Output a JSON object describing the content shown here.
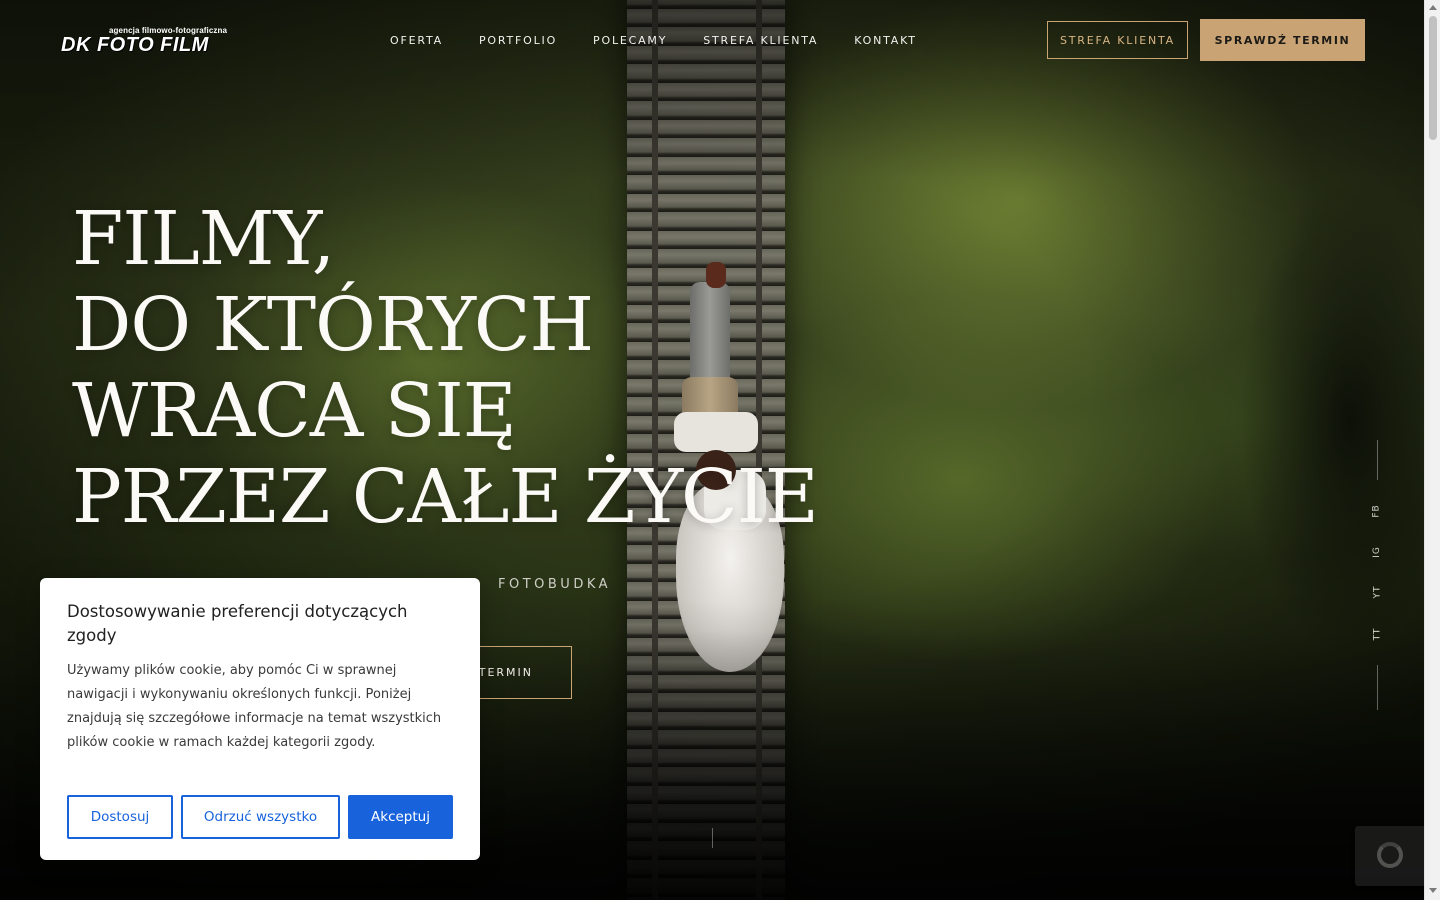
{
  "brand": {
    "tagline": "agencja filmowo-fotograficzna",
    "name": "DK FOTO FILM"
  },
  "nav": {
    "items": [
      "OFERTA",
      "PORTFOLIO",
      "POLECAMY",
      "STREFA KLIENTA",
      "KONTAKT"
    ]
  },
  "header_buttons": {
    "client_zone": "STREFA KLIENTA",
    "check_date": "SPRAWDŹ TERMIN"
  },
  "hero": {
    "headline_lines": [
      "FILMY,",
      "DO KTÓRYCH",
      "WRACA SIĘ",
      "PRZEZ CAŁE ŻYCIE"
    ],
    "subline_visible": "FOTOBUDKA",
    "cta_visible": "TERMIN"
  },
  "social": [
    "FB",
    "IG",
    "YT",
    "TT"
  ],
  "cookie": {
    "title": "Dostosowywanie preferencji dotyczących zgody",
    "body": "Używamy plików cookie, aby pomóc Ci w sprawnej nawigacji i wykonywaniu określonych funkcji. Poniżej znajdują się szczegółowe informacje na temat wszystkich plików cookie w ramach każdej kategorii zgody.",
    "buttons": {
      "customize": "Dostosuj",
      "reject": "Odrzuć wszystko",
      "accept": "Akceptuj"
    }
  },
  "colors": {
    "gold": "#c9a374",
    "cookie_blue": "#1863dc"
  }
}
